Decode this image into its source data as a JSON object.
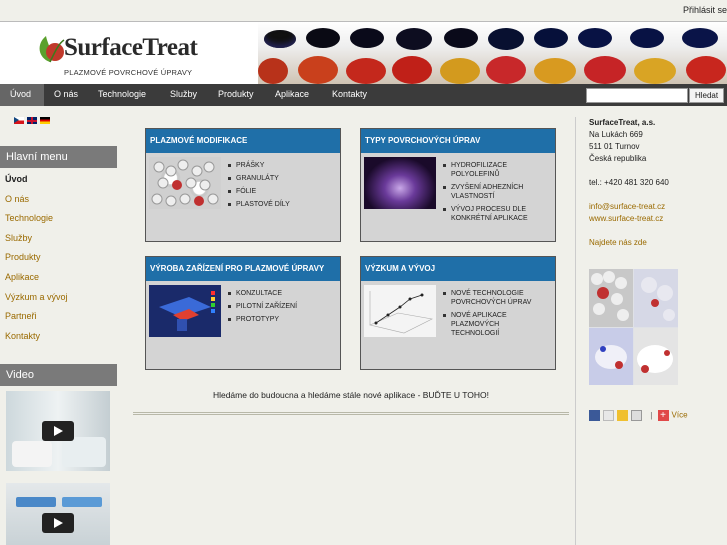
{
  "topbar": {
    "login_label": "Přihlásit se"
  },
  "header": {
    "brand": "SurfaceTreat",
    "tagline": "PLAZMOVÉ POVRCHOVÉ ÚPRAVY",
    "brand_color": "#c0392b",
    "leaf_color": "#5aa02c"
  },
  "nav": {
    "items": [
      "Úvod",
      "O nás",
      "Technologie",
      "Služby",
      "Produkty",
      "Aplikace",
      "Kontakty"
    ],
    "active": "Úvod"
  },
  "search": {
    "placeholder": "",
    "button_label": "Hledat"
  },
  "sidebar": {
    "flags": [
      "cz-flag-icon",
      "uk-flag-icon",
      "de-flag-icon"
    ],
    "menu_title": "Hlavní menu",
    "menu_items": [
      "Úvod",
      "O nás",
      "Technologie",
      "Služby",
      "Produkty",
      "Aplikace",
      "Výzkum a vývoj",
      "Partneři",
      "Kontakty"
    ],
    "video_title": "Video"
  },
  "boxes": [
    {
      "title": "PLAZMOVÉ MODIFIKACE",
      "items": [
        "PRÁŠKY",
        "GRANULÁTY",
        "FÓLIE",
        "PLASTOVÉ DÍLY"
      ]
    },
    {
      "title": "TYPY POVRCHOVÝCH ÚPRAV",
      "items": [
        "HYDROFILIZACE POLYOLEFINŮ",
        "ZVYŠENÍ ADHEZNÍCH VLASTNOSTÍ",
        "VÝVOJ PROCESU DLE KONKRÉTNÍ APLIKACE"
      ]
    },
    {
      "title": "VÝROBA ZAŘÍZENÍ PRO PLAZMOVÉ ÚPRAVY",
      "items": [
        "KONZULTACE",
        "PILOTNÍ ZAŘÍZENÍ",
        "PROTOTYPY"
      ]
    },
    {
      "title": "VÝZKUM A VÝVOJ",
      "items": [
        "NOVÉ TECHNOLOGIE POVRCHOVÝCH ÚPRAV",
        "NOVÉ APLIKACE PLAZMOVÝCH TECHNOLOGIÍ"
      ]
    }
  ],
  "motto": "Hledáme do budoucna a hledáme stále nové aplikace - BUĎTE U TOHO!",
  "contact": {
    "company": "SurfaceTreat, a.s.",
    "street": "Na Lukách 669",
    "city": "511 01 Turnov",
    "country": "Česká republika",
    "phone": "tel.: +420 481 320 640",
    "email": "info@surface-treat.cz",
    "web": "www.surface-treat.cz",
    "map_link": "Najdete nás zde"
  },
  "share": {
    "more_label": "Více"
  },
  "colors": {
    "nav_bg": "#3b3b3b",
    "box_header": "#1f6fa8",
    "link": "#9a6a00"
  }
}
